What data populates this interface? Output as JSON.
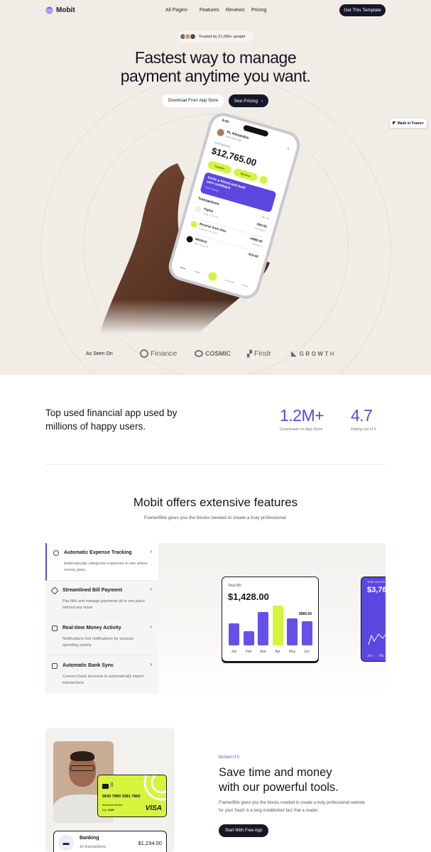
{
  "nav": {
    "brand": "Mobit",
    "links": [
      "All Pages",
      "Features",
      "Reviews",
      "Pricing"
    ],
    "cta": "Get This Template"
  },
  "hero": {
    "trusted": "Trusted by 21,000+ people",
    "title_line1": "Fastest way to manage",
    "title_line2": "payment anytime you want.",
    "btn_store": "Download From App Store",
    "btn_pricing": "See Pricing",
    "made_in": "Made in Framer"
  },
  "phone": {
    "time": "9:41",
    "greeting": "Hi, Alexandra",
    "greeting_sub": "Good Morning!",
    "balance_label": "Total Balance",
    "balance": "$12,765.00",
    "transfer": "Transfer",
    "receive": "Receive",
    "promo": "Invite a friend and both earn cashback",
    "promo_link": "Invite friends",
    "tx_title": "Transactions",
    "see_all": "See All",
    "tx": [
      {
        "name": "Figma",
        "meta": "Today, 12:20 PM",
        "amount": "-$20.00",
        "type": "Subscription"
      },
      {
        "name": "Receive from Alex",
        "meta": "Yesterday, 09:15 AM",
        "amount": "+$980.00",
        "type": "Money in"
      },
      {
        "name": "Medium",
        "meta": "Mon, 05:30 PM",
        "amount": "-$19.00",
        "type": ""
      }
    ],
    "tabs": [
      "Home",
      "Insight",
      "",
      "My Cards",
      "Profile"
    ]
  },
  "seen_on": {
    "label": "As Seen On",
    "logos": [
      "Finance",
      "COSMIC",
      "Findr",
      "GROWTH"
    ]
  },
  "stats": {
    "headline": "Top used financial app used by millions of happy users.",
    "items": [
      {
        "value": "1.2M+",
        "label": "Downloads on App Store"
      },
      {
        "value": "4.7",
        "label": "Rating out of 5"
      }
    ]
  },
  "features": {
    "title": "Mobit offers extensive features",
    "subtitle": "FramerBite gives you the blocks needed to create a truly professional.",
    "items": [
      {
        "title": "Automatic Expense Tracking",
        "desc": "Automatically categorize expenses to see where money goes.",
        "icon": "target-icon"
      },
      {
        "title": "Streamlined Bill Payment",
        "desc": "Pay bills and manage payments all in one place without any issue.",
        "icon": "tag-icon"
      },
      {
        "title": "Real-time Money Activity",
        "desc": "Notifications Get notifications for unusual spending activity.",
        "icon": "calendar-icon"
      },
      {
        "title": "Automatic Bank Sync",
        "desc": "Connect bank accounts to automatically import transactions.",
        "icon": "bank-icon"
      }
    ]
  },
  "bill_card": {
    "label": "Total Bill",
    "value": "$1,428.00",
    "callout": "$980.00"
  },
  "spend_card": {
    "label": "Total Spendi",
    "value": "$3,76",
    "months": [
      "Jun",
      "Ma"
    ]
  },
  "chart_data": {
    "type": "bar",
    "categories": [
      "Jan",
      "Feb",
      "Mar",
      "Apr",
      "May",
      "Jun"
    ],
    "values": [
      560,
      360,
      860,
      1020,
      690,
      620
    ],
    "highlight": "Apr",
    "colors": {
      "bar": "#6651e8",
      "highlight": "#d4f53c"
    }
  },
  "benefits": {
    "eyebrow": "BENEFITS",
    "title_line1": "Save time and money",
    "title_line2": "with our powerful tools.",
    "desc": "FramerBite gives you the blocks needed to create a truly professional website for your SaaS is a long established fact that a reader.",
    "cta": "Start With Free App",
    "card_number": "5643 7890 3281 7865",
    "card_name": "Alexandra Rhodes",
    "card_exp_label": "Exp",
    "card_exp": "03/28",
    "card_brand": "VISA",
    "bank_title": "Banking",
    "bank_sub": "10 transactions",
    "bank_amount": "$1,234.00"
  },
  "colors": {
    "accent": "#5b47e0",
    "lime": "#d4f53c",
    "dark": "#17172a",
    "hero_bg": "#f1ece5"
  }
}
